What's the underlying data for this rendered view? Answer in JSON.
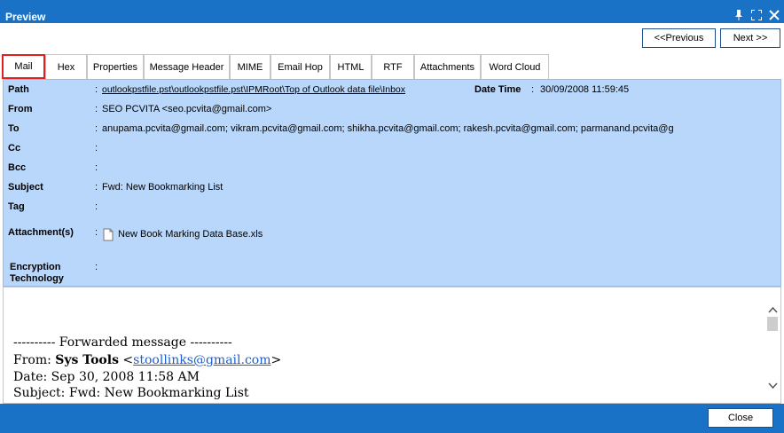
{
  "window": {
    "title": "Preview"
  },
  "nav": {
    "previous_label": "<<Previous",
    "next_label": "Next >>"
  },
  "tabs": [
    {
      "label": "Mail"
    },
    {
      "label": "Hex"
    },
    {
      "label": "Properties"
    },
    {
      "label": "Message Header"
    },
    {
      "label": "MIME"
    },
    {
      "label": "Email Hop"
    },
    {
      "label": "HTML"
    },
    {
      "label": "RTF"
    },
    {
      "label": "Attachments"
    },
    {
      "label": "Word Cloud"
    }
  ],
  "header": {
    "path_label": "Path",
    "path_value": "outlookpstfile.pst\\outlookpstfile.pst\\IPMRoot\\Top of Outlook data file\\Inbox",
    "datetime_label": "Date Time",
    "datetime_value": "30/09/2008 11:59:45",
    "from_label": "From",
    "from_value": "SEO PCVITA <seo.pcvita@gmail.com>",
    "to_label": "To",
    "to_value": "anupama.pcvita@gmail.com; vikram.pcvita@gmail.com; shikha.pcvita@gmail.com; rakesh.pcvita@gmail.com; parmanand.pcvita@g",
    "cc_label": "Cc",
    "bcc_label": "Bcc",
    "subject_label": "Subject",
    "subject_value": "Fwd: New Bookmarking List",
    "tag_label": "Tag",
    "attachments_label": "Attachment(s)",
    "attachment_name": "New Book Marking Data Base.xls",
    "encryption_label_1": "Encryption",
    "encryption_label_2": "Technology"
  },
  "body": {
    "forwarded": "---------- Forwarded message ----------",
    "from_prefix": "From: ",
    "from_name": "Sys Tools",
    "from_email": "stoollinks@gmail.com",
    "date_line": "Date: Sep 30, 2008 11:58 AM",
    "subject_line": "Subject: Fwd: New Bookmarking List"
  },
  "footer": {
    "close_label": "Close"
  },
  "colors": {
    "accent": "#1a72c6",
    "header_bg": "#b9d7fb",
    "active_tab_border": "#e02020"
  }
}
